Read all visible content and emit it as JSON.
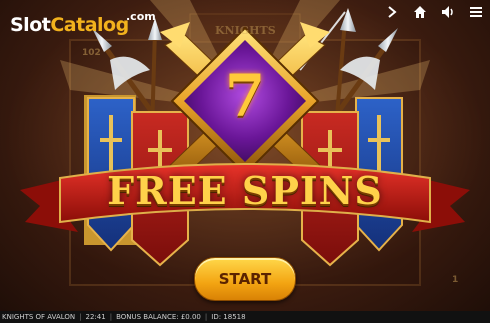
{
  "watermark": {
    "brand_part1": "Slot",
    "brand_part2": "Catalog",
    "suffix": ".com"
  },
  "background": {
    "title": "KNIGHTS",
    "number_left": "102",
    "number_right": "1"
  },
  "feature": {
    "count": "7",
    "title": "FREE SPINS"
  },
  "start_button": {
    "label": "START"
  },
  "toolbar": {
    "icons": [
      "chevron-right-icon",
      "home-icon",
      "speaker-icon",
      "menu-icon"
    ]
  },
  "status_bar": {
    "game_name": "KNIGHTS OF AVALON",
    "time": "22:41",
    "bonus_balance": "BONUS BALANCE: £0.00",
    "id": "ID: 18518"
  },
  "colors": {
    "gold": "#ffc93a",
    "purple": "#7a1aa8",
    "ribbon_red": "#c81d12",
    "banner_blue": "#1f4aa8",
    "button_orange": "#f3a412"
  }
}
